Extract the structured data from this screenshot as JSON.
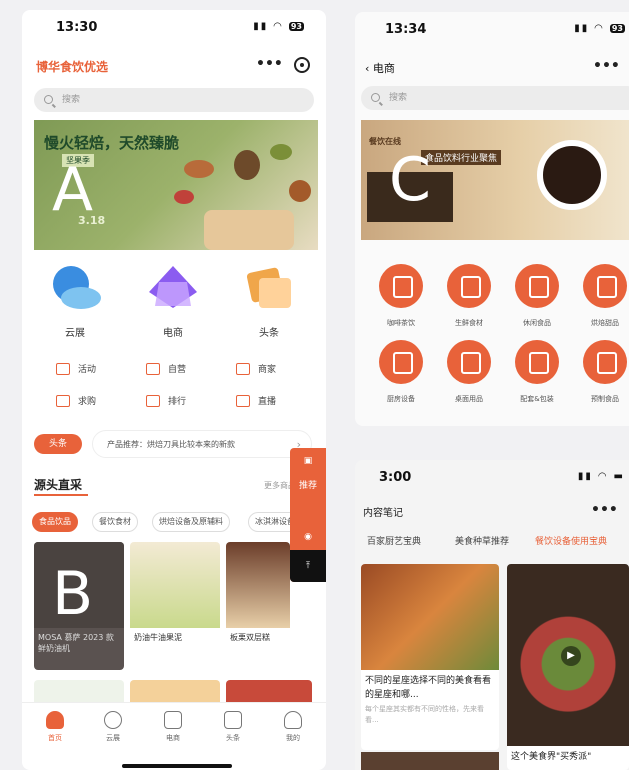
{
  "screens": {
    "a": {
      "marker": "A",
      "status": {
        "time": "13:30",
        "battery": "93"
      },
      "brand": "博华食饮优选",
      "search_placeholder": "搜索",
      "banner": {
        "headline": "慢火轻焙，天然臻脆",
        "sub": "坚果季",
        "date": "3.18"
      },
      "categories": [
        {
          "label": "云展",
          "icon": "cloud-expo-icon"
        },
        {
          "label": "电商",
          "icon": "ecommerce-bag-icon"
        },
        {
          "label": "头条",
          "icon": "headline-news-icon"
        }
      ],
      "quick_links_row1": [
        "活动",
        "自营",
        "商家"
      ],
      "quick_links_row2": [
        "求购",
        "排行",
        "直播"
      ],
      "notice": {
        "tag": "头条",
        "text": "产品推荐：烘焙刀具比较本来的新款",
        "chevron": "›"
      },
      "section": {
        "title": "源头直采",
        "more": "更多商品"
      },
      "chips": [
        "食品饮品",
        "餐饮食材",
        "烘焙设备及原辅料",
        "冰淇淋设备"
      ],
      "products": [
        {
          "name": "MOSA 慕萨 2023 款鲜奶油机",
          "marker": "B"
        },
        {
          "name": "奶油牛油果泥",
          "marker": ""
        },
        {
          "name": "板栗双层糕",
          "marker": ""
        }
      ],
      "float_panel": {
        "top_icon": "cart-icon",
        "text": "推荐",
        "bottom_icon": "pin-icon"
      },
      "tabbar": [
        "首页",
        "云展",
        "电商",
        "头条",
        "我的"
      ]
    },
    "c": {
      "marker": "C",
      "status": {
        "time": "13:34",
        "battery": "93"
      },
      "title": "电商",
      "back_glyph": "‹",
      "search_placeholder": "搜索",
      "banner": {
        "line1": "餐饮在线",
        "line2": "食品饮料行业聚焦"
      },
      "grid_row1": [
        "咖啡茶饮",
        "生鲜食材",
        "休闲食品",
        "烘焙甜品"
      ],
      "grid_row2": [
        "厨房设备",
        "桌面用品",
        "配套&包装",
        "预制食品"
      ]
    },
    "d": {
      "status": {
        "time": "3:00"
      },
      "title": "内容笔记",
      "tabs": [
        "百家厨艺宝典",
        "美食种草推荐",
        "餐饮设备使用宝典"
      ],
      "cards": [
        {
          "title": "不同的星座选择不同的美食看看的星座和哪...",
          "desc": "每个星座其实都有不同的性格，先来看看..."
        },
        {
          "title": "这个美食界\"买秀派\"",
          "desc": ""
        }
      ]
    }
  },
  "colors": {
    "accent": "#e8623a",
    "banner_green": "#8aa35c",
    "dark": "#111111"
  }
}
